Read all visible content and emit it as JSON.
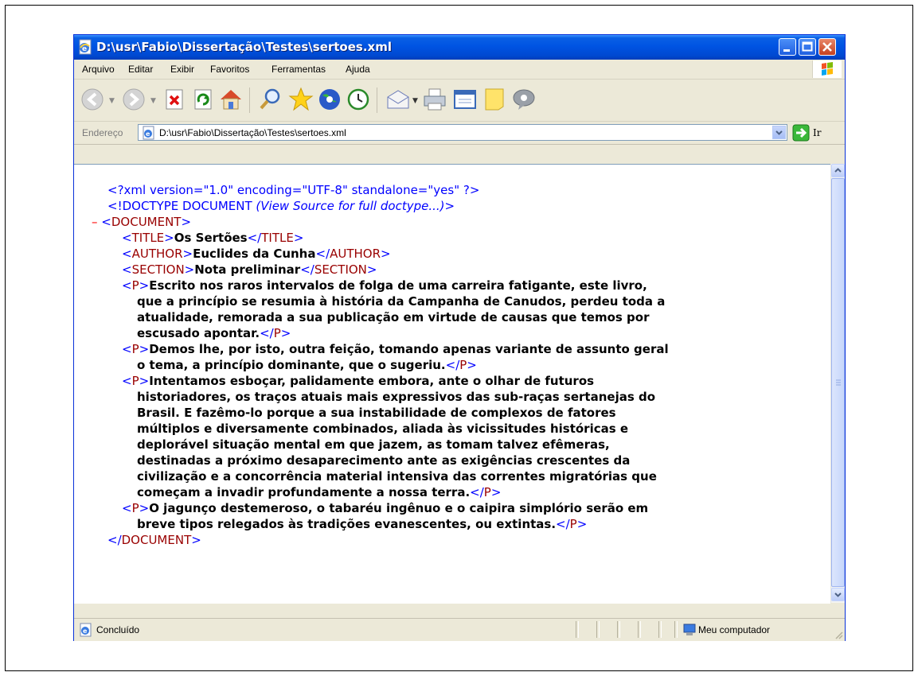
{
  "window": {
    "title": "D:\\usr\\Fabio\\Dissertação\\Testes\\sertoes.xml"
  },
  "menu": [
    "Arquivo",
    "Editar",
    "Exibir",
    "Favoritos",
    "Ferramentas",
    "Ajuda"
  ],
  "toolbar": {
    "icons": [
      "back-icon",
      "forward-icon",
      "stop-icon",
      "refresh-icon",
      "home-icon",
      "search-icon",
      "favorites-icon",
      "media-icon",
      "history-icon",
      "mail-icon",
      "print-icon",
      "edit-icon",
      "discuss-icon",
      "messenger-icon"
    ]
  },
  "address": {
    "label": "Endereço",
    "value": "D:\\usr\\Fabio\\Dissertação\\Testes\\sertoes.xml",
    "go_label": "Ir"
  },
  "xml": {
    "decl": "<?xml version=\"1.0\" encoding=\"UTF-8\" standalone=\"yes\" ?>",
    "doctype_open": "<!DOCTYPE DOCUMENT ",
    "doctype_note": "(View Source for full doctype...)",
    "doctype_close": ">",
    "collapse": "–",
    "document_tag": "DOCUMENT",
    "title_tag": "TITLE",
    "title": "Os Sertões",
    "author_tag": "AUTHOR",
    "author": "Euclides da Cunha",
    "section_tag": "SECTION",
    "section": "Nota preliminar",
    "p_tag": "P",
    "p1": [
      "Escrito nos raros intervalos de folga de uma carreira fatigante, este livro,",
      "que a princípio se resumia à história da Campanha de Canudos, perdeu toda a",
      "atualidade, remorada a sua publicação em virtude de causas que temos por",
      "escusado apontar."
    ],
    "p2": [
      "Demos lhe, por isto, outra feição, tomando apenas variante de assunto geral",
      "o tema, a princípio dominante, que o sugeriu."
    ],
    "p3": [
      "Intentamos esboçar, palidamente embora, ante o olhar de futuros",
      "historiadores, os traços atuais mais expressivos das sub-raças sertanejas do",
      "Brasil. E fazêmo-lo porque a sua instabilidade de complexos de fatores",
      "múltiplos e diversamente combinados, aliada às vicissitudes históricas e",
      "deplorável situação mental em que jazem, as tomam talvez efêmeras,",
      "destinadas a próximo desaparecimento ante as exigências crescentes da",
      "civilização e a concorrência material intensiva das correntes migratórias que",
      "começam a invadir profundamente a nossa terra."
    ],
    "p4": [
      "O jagunço destemeroso, o tabaréu ingênuo e o caipira simplório serão em",
      "breve tipos relegados às tradições evanescentes, ou extintas."
    ]
  },
  "status": {
    "text": "Concluído",
    "zone": "Meu computador"
  }
}
